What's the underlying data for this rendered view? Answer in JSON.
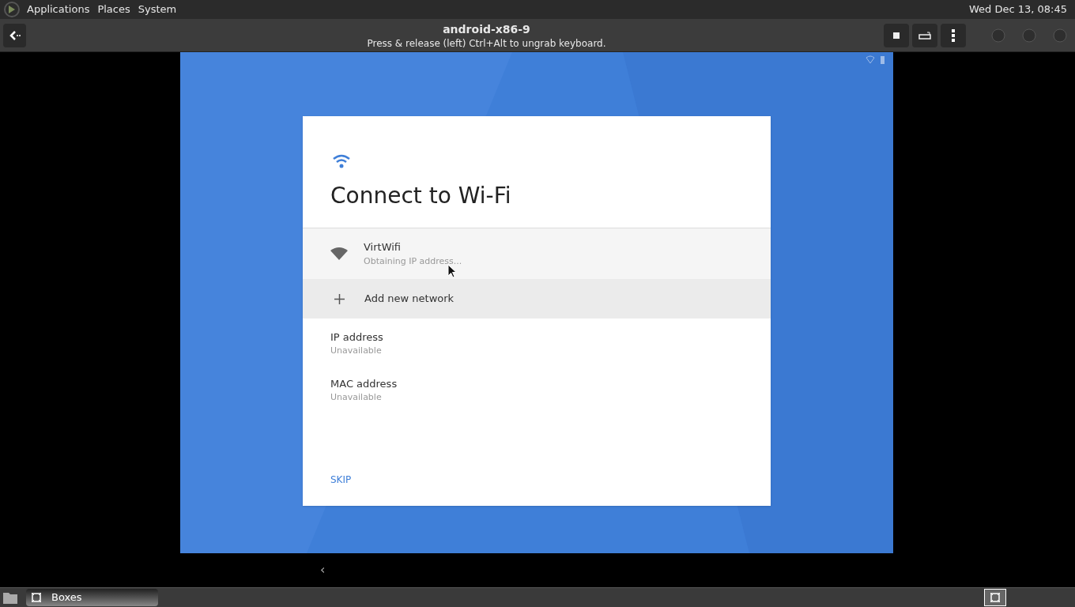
{
  "top_panel": {
    "menus": [
      "Applications",
      "Places",
      "System"
    ],
    "clock": "Wed Dec 13, 08:45"
  },
  "header": {
    "title": "android-x86-9",
    "subtitle": "Press & release (left) Ctrl+Alt to ungrab keyboard."
  },
  "dialog": {
    "title": "Connect to Wi-Fi",
    "networks": [
      {
        "kind": "network",
        "name": "VirtWifi",
        "status": "Obtaining IP address..."
      },
      {
        "kind": "add",
        "name": "Add new network"
      }
    ],
    "details": [
      {
        "label": "IP address",
        "value": "Unavailable"
      },
      {
        "label": "MAC address",
        "value": "Unavailable"
      }
    ],
    "skip": "SKIP"
  },
  "navigation": {
    "back": "‹"
  },
  "taskbar": {
    "tasks": [
      {
        "label": "Boxes",
        "selected": true
      }
    ]
  }
}
